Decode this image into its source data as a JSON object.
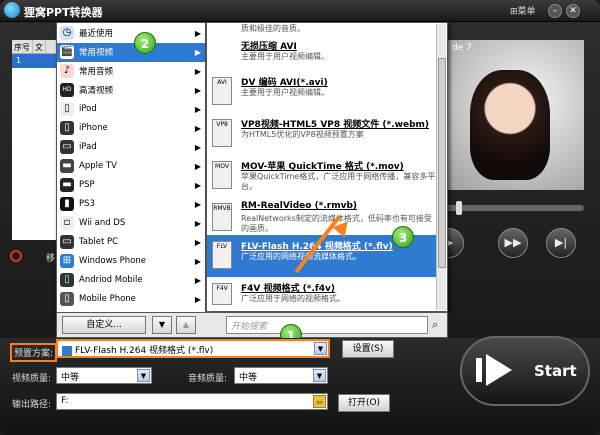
{
  "app": {
    "title": "狸窝PPT转换器",
    "menu_label": "菜单"
  },
  "file_table": {
    "headers": [
      "序号",
      "文"
    ],
    "rows": [
      [
        "1",
        ""
      ]
    ]
  },
  "preview": {
    "tab_label": "de 7"
  },
  "left_status": "移",
  "menu1": {
    "items": [
      {
        "icon": "clock-icon",
        "label": "最近使用",
        "arrow": true
      },
      {
        "icon": "film-icon",
        "label": "常用视频",
        "arrow": true,
        "selected": true
      },
      {
        "icon": "music-icon",
        "label": "常用音频",
        "arrow": true
      },
      {
        "icon": "hd-icon",
        "label": "高清视频",
        "arrow": true
      },
      {
        "icon": "ipod-icon",
        "label": "iPod",
        "arrow": true
      },
      {
        "icon": "iphone-icon",
        "label": "iPhone",
        "arrow": true
      },
      {
        "icon": "ipad-icon",
        "label": "iPad",
        "arrow": true
      },
      {
        "icon": "apple-tv-icon",
        "label": "Apple TV",
        "arrow": true
      },
      {
        "icon": "psp-icon",
        "label": "PSP",
        "arrow": true
      },
      {
        "icon": "ps3-icon",
        "label": "PS3",
        "arrow": true
      },
      {
        "icon": "wii-ds-icon",
        "label": "Wii and DS",
        "arrow": true
      },
      {
        "icon": "tablet-pc-icon",
        "label": "Tablet PC",
        "arrow": true
      },
      {
        "icon": "windows-phone-icon",
        "label": "Windows Phone",
        "arrow": true
      },
      {
        "icon": "android-icon",
        "label": "Andriod Mobile",
        "arrow": true
      },
      {
        "icon": "mobile-phone-icon",
        "label": "Mobile Phone",
        "arrow": true
      }
    ]
  },
  "menu2": {
    "items": [
      {
        "icon_text": "",
        "title": "",
        "desc": "质和极佳的音质。"
      },
      {
        "icon_text": "AVI",
        "title": "无损压缩 AVI",
        "desc": "主要用于用户视频编辑。"
      },
      {
        "icon_text": "AVI",
        "title": "DV 编码 AVI(*.avi)",
        "desc": "主要用于用户视频编辑。"
      },
      {
        "icon_text": "VP8",
        "title": "VP8视频-HTML5 VP8 视频文件 (*.webm)",
        "desc": "为HTML5优化的VP8视频预置方案"
      },
      {
        "icon_text": "MOV",
        "title": "MOV-苹果 QuickTime 格式 (*.mov)",
        "desc": "苹果QuickTime格式，广泛应用于网络传播，兼容多平台。"
      },
      {
        "icon_text": "RMVB",
        "title": "RM-RealVideo (*.rmvb)",
        "desc": "RealNetworks制定的流媒体格式，低码率也有可接受的画质。"
      },
      {
        "icon_text": "FLV",
        "title": "FLV-Flash H.264 视频格式 (*.flv)",
        "desc": "广泛应用的网络视频流媒体格式。",
        "selected": true
      },
      {
        "icon_text": "F4V",
        "title": "F4V 视频格式 (*.f4v)",
        "desc": "广泛应用于网络的视频格式。"
      }
    ]
  },
  "menu_footer": {
    "custom_label": "自定义...",
    "search_placeholder": "开始搜索"
  },
  "badges": [
    "1",
    "2",
    "3"
  ],
  "bottom": {
    "preset_label": "预置方案:",
    "preset_value": "FLV-Flash H.264 视频格式 (*.flv)",
    "settings_label": "设置(S)",
    "video_quality_label": "视频质量:",
    "video_quality_value": "中等",
    "audio_quality_label": "音频质量:",
    "audio_quality_value": "中等",
    "output_label": "输出路径:",
    "output_value": "F:",
    "open_label": "打开(O)",
    "start_label": "Start"
  },
  "colors": {
    "accent_orange": "#ff7f1a",
    "selection_blue": "#2f7bd1",
    "badge_green": "#2e9d16"
  }
}
